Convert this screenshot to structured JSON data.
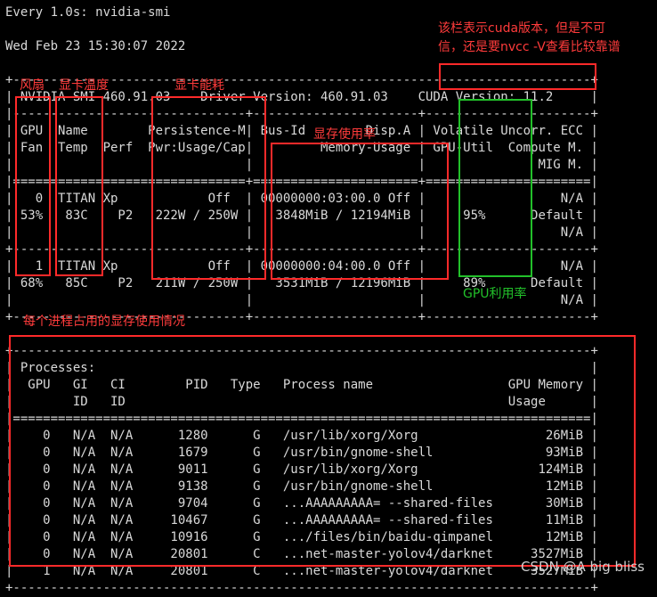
{
  "terminal": {
    "lines": [
      "Every 1.0s: nvidia-smi",
      "",
      "Wed Feb 23 15:30:07 2022",
      "",
      "+-----------------------------------------------------------------------------+",
      "| NVIDIA-SMI 460.91.03    Driver Version: 460.91.03    CUDA Version: 11.2     |",
      "|-------------------------------+----------------------+----------------------+",
      "| GPU  Name        Persistence-M| Bus-Id        Disp.A | Volatile Uncorr. ECC |",
      "| Fan  Temp  Perf  Pwr:Usage/Cap|         Memory-Usage | GPU-Util  Compute M. |",
      "|                               |                      |               MIG M. |",
      "|===============================+======================+======================|",
      "|   0  TITAN Xp            Off  | 00000000:03:00.0 Off |                  N/A |",
      "| 53%   83C    P2   222W / 250W |   3848MiB / 12194MiB |     95%      Default |",
      "|                               |                      |                  N/A |",
      "+-------------------------------+----------------------+----------------------+",
      "|   1  TITAN Xp            Off  | 00000000:04:00.0 Off |                  N/A |",
      "| 68%   85C    P2   211W / 250W |   3531MiB / 12196MiB |     89%      Default |",
      "|                               |                      |                  N/A |",
      "+-------------------------------+----------------------+----------------------+",
      "",
      "+-----------------------------------------------------------------------------+",
      "| Processes:                                                                  |",
      "|  GPU   GI   CI        PID   Type   Process name                  GPU Memory |",
      "|        ID   ID                                                   Usage      |",
      "|=============================================================================|",
      "|    0   N/A  N/A      1280      G   /usr/lib/xorg/Xorg                 26MiB |",
      "|    0   N/A  N/A      1679      G   /usr/bin/gnome-shell               93MiB |",
      "|    0   N/A  N/A      9011      G   /usr/lib/xorg/Xorg                124MiB |",
      "|    0   N/A  N/A      9138      G   /usr/bin/gnome-shell               12MiB |",
      "|    0   N/A  N/A      9704      G   ...AAAAAAAAA= --shared-files       30MiB |",
      "|    0   N/A  N/A     10467      G   ...AAAAAAAAA= --shared-files       11MiB |",
      "|    0   N/A  N/A     10916      G   .../files/bin/baidu-qimpanel       12MiB |",
      "|    0   N/A  N/A     20801      C   ...net-master-yolov4/darknet     3527MiB |",
      "|    1   N/A  N/A     20801      C   ...net-master-yolov4/darknet     3527MiB |",
      "+-----------------------------------------------------------------------------+"
    ]
  },
  "annotations": {
    "cuda_note": [
      "该栏表示cuda版本，但是不可",
      "信，还是要nvcc -V查看比较靠谱"
    ],
    "fan_label": "风扇",
    "temp_label": "显卡温度",
    "power_label": "显卡能耗",
    "memory_label": "显存使用率",
    "gpu_util_label": "GPU利用率",
    "process_memory_label": "每个进程占用的显存使用情况"
  },
  "watermark": "CSDN @A big bliss",
  "colors": {
    "background": "#000000",
    "text": "#d9d9d9",
    "annotation_red": "#ff2a2a",
    "annotation_green": "#22c02a"
  }
}
